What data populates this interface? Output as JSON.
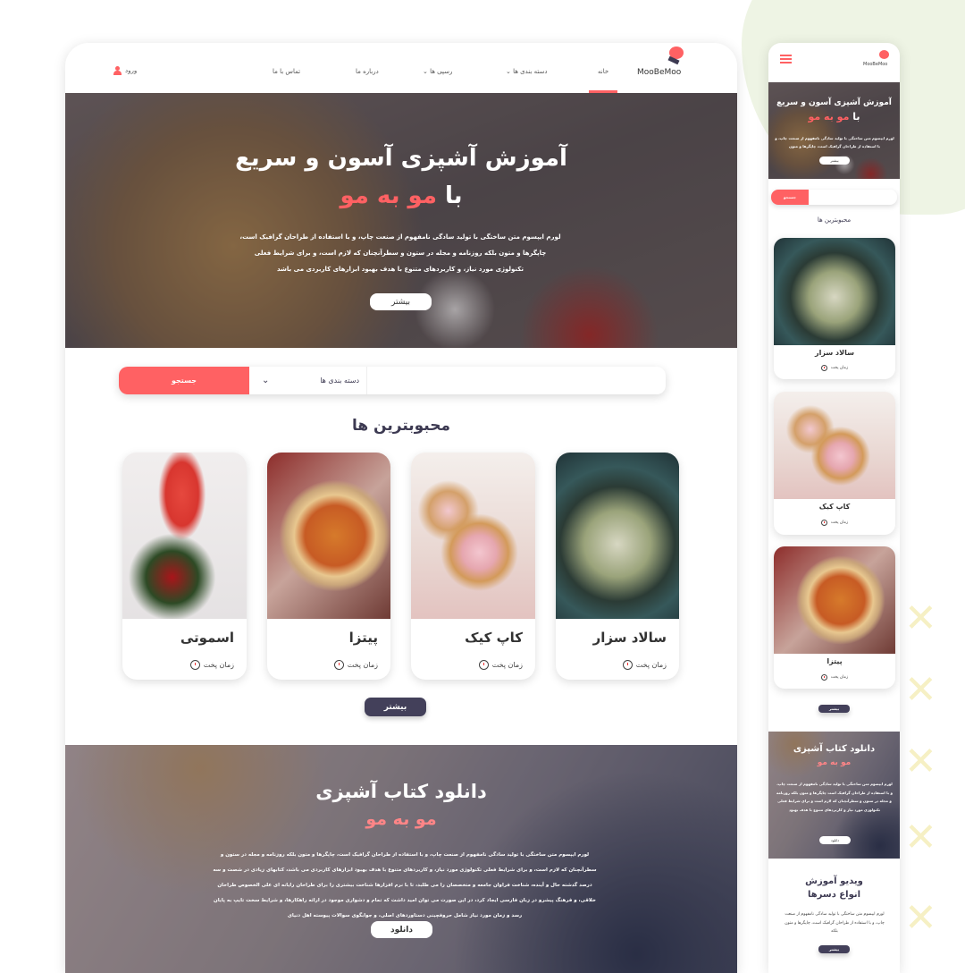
{
  "brand": {
    "name": "MooBeMoo",
    "accent": "#ff6163",
    "dark": "#43405a"
  },
  "nav": {
    "home": "خانه",
    "categories": "دسته بندی ها",
    "recipes": "رسپی ها",
    "about": "درباره ما",
    "contact": "تماس با ما",
    "login": "ورود"
  },
  "hero": {
    "title_line1": "آموزش آشپزی آسون و سریع",
    "title_with": "با",
    "title_accent": "مو به مو",
    "paragraph": "لورم ایپسوم متن ساختگی با تولید سادگی نامفهوم از صنعت چاپ، و با استفاده از طراحان گرافیک است، چاپگرها و متون بلکه روزنامه و مجله  در ستون و سطرآنچنان که لازم است، و برای شرایط فعلی تکنولوژی مورد نیاز، و کاربردهای متنوع با هدف بهبود ابزارهای کاربردی می باشد",
    "button": "بیشتر"
  },
  "search": {
    "category_placeholder": "دسته بندی ها",
    "button": "جستجو"
  },
  "popular": {
    "title": "محبوبترین ها",
    "more": "بیشتر",
    "cook_time_label": "زمان پخت",
    "items": [
      {
        "name": "سالاد سزار"
      },
      {
        "name": "کاپ کیک"
      },
      {
        "name": "پیتزا"
      },
      {
        "name": "اسموتی"
      }
    ]
  },
  "download": {
    "title": "دانلود کتاب آشپزی",
    "accent": "مو به مو",
    "paragraph": "لورم ایپسوم متن ساختگی با تولید سادگی نامفهوم از صنعت چاپ، و با استفاده از طراحان گرافیک است، چاپگرها و متون بلکه روزنامه و مجله در ستون و سطرآنچنان که لازم است، و برای شرایط فعلی تکنولوژی مورد نیاز، و کاربردهای متنوع با هدف بهبود ابزارهای کاربردی می باشد، کتابهای زیادی در شصت و سه درصد گذشته حال و آینده، شناخت فراوان جامعه و متخصصان را می طلبد، تا با نرم افزارها شناخت بیشتری را برای طراحان رایانه ای علی الخصوص طراحان خلاقی، و فرهنگ پیشرو در زبان فارسی ایجاد کرد، در این صورت می توان امید داشت که تمام و دشواری موجود در ارائه راهکارها، و شرایط سخت تایپ به پایان رسد و زمان مورد نیاز شامل حروفچینی دستاوردهای اصلی، و جوابگوی سوالات پیوسته اهل دنیای",
    "button": "دانلود"
  },
  "mobile": {
    "hero_paragraph": "لورم ایپسوم متن ساختگی با تولید سادگی نامفهوم از صنعت چاپ، و با استفاده از طراحان گرافیک است، چاپگرها و متون",
    "download_paragraph": "لورم ایپسوم متن ساختگی با تولید سادگی نامفهوم از صنعت چاپ، و با استفاده از طراحان گرافیک است چاپگرها و متون بلکه روزنامه و مجله در ستون و سطرآنچنان که لازم است و برای شرایط فعلی تکنولوژی مورد نیاز و کاربردهای متنوع با هدف بهبود",
    "items": [
      {
        "name": "سالاد سزار"
      },
      {
        "name": "کاپ کیک"
      },
      {
        "name": "پیتزا"
      }
    ],
    "video": {
      "title_line1": "ویدیو آموزش",
      "title_line2": "انواع دسرها",
      "paragraph": "لورم ایپسوم متن ساختگی با تولید سادگی نامفهوم از صنعت چاپ، و با استفاده از طراحان گرافیک است، چاپگرها و متون بلکه",
      "button": "بیشتر"
    }
  }
}
